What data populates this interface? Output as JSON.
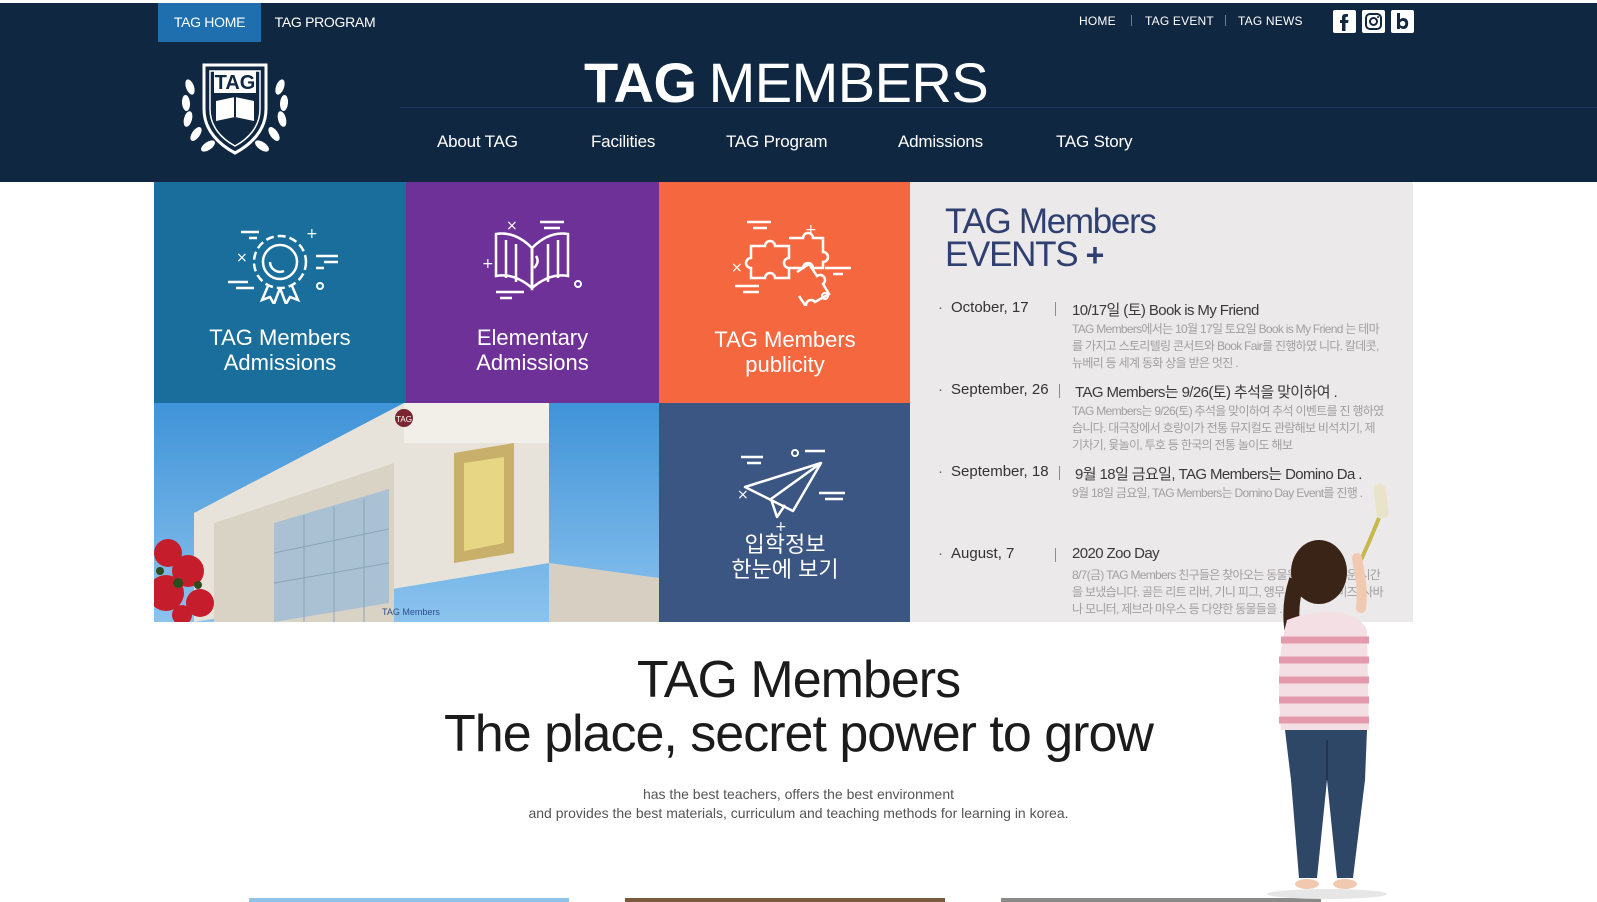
{
  "header": {
    "top_tabs": [
      {
        "label": "TAG HOME",
        "active": true
      },
      {
        "label": "TAG PROGRAM",
        "active": false
      }
    ],
    "util_links": [
      "HOME",
      "TAG EVENT",
      "TAG NEWS"
    ],
    "social_icons": [
      "facebook-icon",
      "instagram-icon",
      "blog-icon"
    ],
    "brand": {
      "bold": "TAG",
      "light": "MEMBERS"
    },
    "logo_text": "TAG",
    "nav": [
      "About TAG",
      "Facilities",
      "TAG Program",
      "Admissions",
      "TAG Story"
    ]
  },
  "tiles": [
    {
      "line1": "TAG Members",
      "line2": "Admissions",
      "color": "#1a6e9b",
      "icon": "gear-badge-icon"
    },
    {
      "line1": "Elementary",
      "line2": "Admissions",
      "color": "#6e3197",
      "icon": "book-icon"
    },
    {
      "line1": "TAG Members",
      "line2": "publicity",
      "color": "#f5673f",
      "icon": "puzzle-icon"
    },
    {
      "line1": "입학정보",
      "line2": "한눈에 보기",
      "color": "#3b5682",
      "icon": "paper-plane-icon"
    }
  ],
  "events": {
    "title_line1": "TAG Members",
    "title_line2": "EVENTS",
    "title_plus": "+",
    "items": [
      {
        "date": "October, 17",
        "title": "10/17일 (토) Book is My Friend",
        "desc": "TAG Members에서는 10월 17일 토요일 Book is My Friend 는 테마를 가지고 스토리텔링 콘서트와 Book Fair를 진행하였 니다.  칼데콧, 뉴베리 등 세계 동화 상을 받은 멋진 ."
      },
      {
        "date": "September, 26",
        "title": "TAG Members는 9/26(토) 추석을 맞이하여 .",
        "desc": "TAG Members는 9/26(토) 추석을 맞이하여 추석 이벤트를 진 행하였습니다. 대극장에서 호랑이가 전통 뮤지컬도 관람해보 비석치기, 제기차기, 윷놀이, 투호 등 한국의 전통 놀이도 해보"
      },
      {
        "date": "September, 18",
        "title": "9월 18일 금요일, TAG Members는 Domino Da .",
        "desc": "    9월 18일 금요일, TAG Members는 Domino Day Event를 진행 ."
      },
      {
        "date": "August, 7",
        "title": "2020 Zoo Day",
        "desc": "8/7(금) TAG Members 친구들은 찾아오는 동물원과 함께 즐 운 시간을 보냈습니다. 골든 리트 리버, 기니 피그, 앵무새, 친 노 버미즈, 사바나 모니터, 제브라 마우스 등 다양한 동물들을 ."
      }
    ]
  },
  "photo": {
    "banner_text": "TAG",
    "signage": "TAG Members"
  },
  "slogan": {
    "line1": "TAG Members",
    "line2": "The place, secret power to grow",
    "sub1": "has the best teachers, offers the best environment",
    "sub2": "and provides the best materials, curriculum and teaching methods for learning in korea."
  }
}
